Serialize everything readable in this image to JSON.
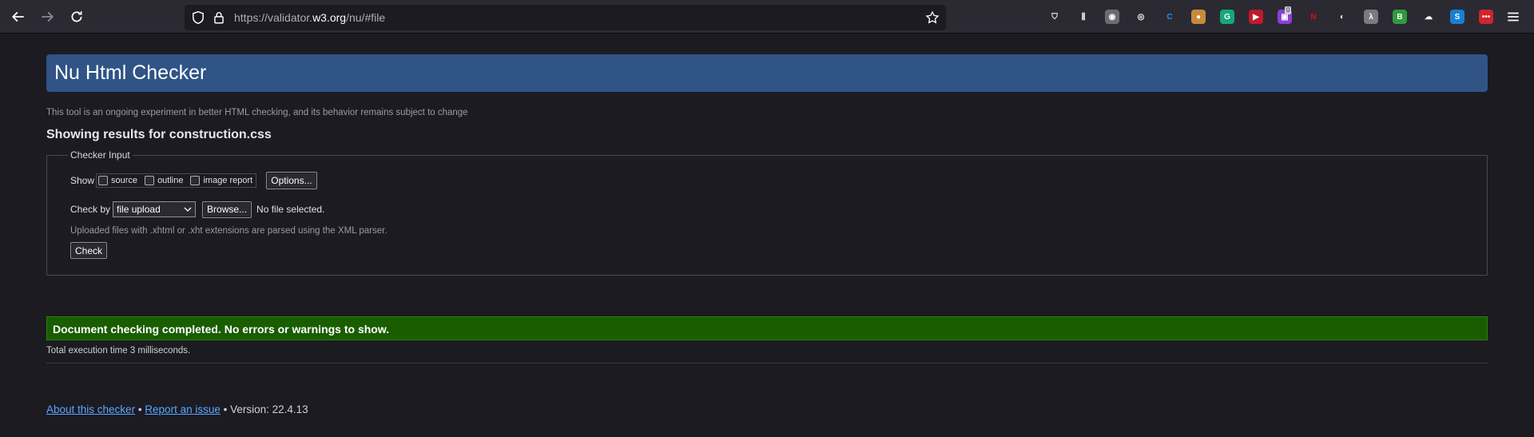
{
  "browser": {
    "url_prefix": "https://validator.",
    "url_host": "w3.org",
    "url_suffix": "/nu/#file",
    "extensions": [
      {
        "name": "pocket-icon",
        "color": "#2b2a33",
        "glyph": "⛉"
      },
      {
        "name": "library-icon",
        "color": "#2b2a33",
        "glyph": "⫼"
      },
      {
        "name": "ext-1-icon",
        "color": "#6b6b73",
        "glyph": "◉"
      },
      {
        "name": "ext-2-icon",
        "color": "#2b2a33",
        "glyph": "◎"
      },
      {
        "name": "ext-3-icon",
        "color": "#2b2a33",
        "glyph": "C"
      },
      {
        "name": "ext-4-icon",
        "color": "#c78a3a",
        "glyph": "●"
      },
      {
        "name": "grammarly-icon",
        "color": "#15a77c",
        "glyph": "G"
      },
      {
        "name": "ext-5-icon",
        "color": "#c0192b",
        "glyph": "▶"
      },
      {
        "name": "ext-6-icon",
        "color": "#8b3fd6",
        "glyph": "▣"
      },
      {
        "name": "netflix-icon",
        "color": "#2b2a33",
        "glyph": "N"
      },
      {
        "name": "ext-7-icon",
        "color": "#2b2a33",
        "glyph": "◐"
      },
      {
        "name": "ext-8-icon",
        "color": "#7a7a82",
        "glyph": "λ"
      },
      {
        "name": "ext-9-icon",
        "color": "#2e9b3c",
        "glyph": "B"
      },
      {
        "name": "ext-10-icon",
        "color": "#2b2a33",
        "glyph": "☁"
      },
      {
        "name": "ext-11-icon",
        "color": "#1a7fd4",
        "glyph": "S"
      },
      {
        "name": "ext-12-icon",
        "color": "#d1232a",
        "glyph": "•••"
      }
    ],
    "badge_count": "0"
  },
  "page": {
    "title": "Nu Html Checker",
    "intro": "This tool is an ongoing experiment in better HTML checking, and its behavior remains subject to change",
    "results_for": "Showing results for construction.css",
    "checker": {
      "legend": "Checker Input",
      "show_label": "Show",
      "checkboxes": [
        "source",
        "outline",
        "image report"
      ],
      "options_button": "Options...",
      "check_by_label": "Check by",
      "check_by_value": "file upload",
      "browse_button": "Browse...",
      "file_status": "No file selected.",
      "note": "Uploaded files with .xhtml or .xht extensions are parsed using the XML parser.",
      "check_button": "Check"
    },
    "success_message": "Document checking completed. No errors or warnings to show.",
    "exec_time": "Total execution time 3 milliseconds.",
    "footer": {
      "about_link": "About this checker",
      "sep1": " • ",
      "report_link": "Report an issue",
      "version": " • Version: 22.4.13"
    }
  },
  "colors": {
    "title_bar": "#2f5485",
    "success_bg": "#1a5d00",
    "link": "#59a8ff"
  }
}
